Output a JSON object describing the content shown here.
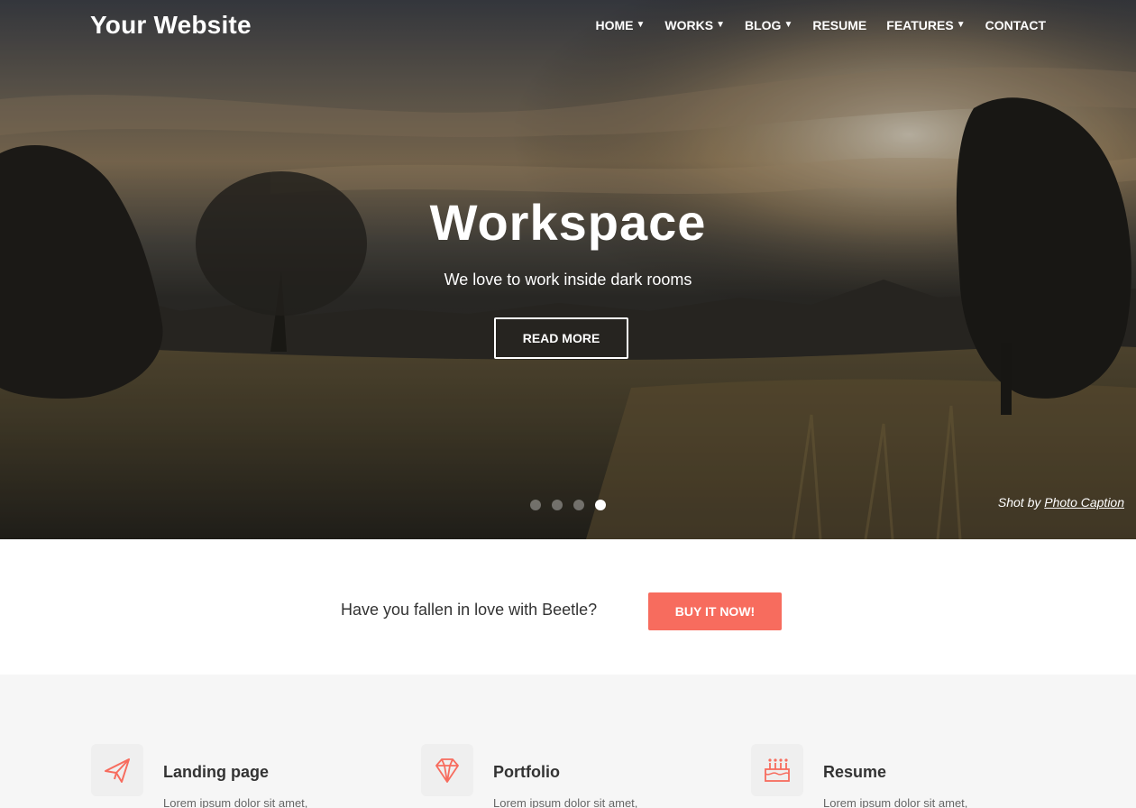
{
  "header": {
    "logo": "Your Website",
    "nav": [
      {
        "label": "HOME",
        "dropdown": true
      },
      {
        "label": "WORKS",
        "dropdown": true
      },
      {
        "label": "BLOG",
        "dropdown": true
      },
      {
        "label": "RESUME",
        "dropdown": false
      },
      {
        "label": "FEATURES",
        "dropdown": true
      },
      {
        "label": "CONTACT",
        "dropdown": false
      }
    ]
  },
  "hero": {
    "title": "Workspace",
    "subtitle": "We love to work inside dark rooms",
    "button_label": "READ MORE",
    "slides_total": 4,
    "active_slide": 4,
    "caption_prefix": "Shot by",
    "caption_link": "Photo Caption"
  },
  "cta": {
    "text": "Have you fallen in love with Beetle?",
    "button_label": "BUY IT NOW!"
  },
  "features": [
    {
      "title": "Landing page",
      "description": "Lorem ipsum dolor sit amet,",
      "icon": "paper-plane-icon"
    },
    {
      "title": "Portfolio",
      "description": "Lorem ipsum dolor sit amet,",
      "icon": "diamond-icon"
    },
    {
      "title": "Resume",
      "description": "Lorem ipsum dolor sit amet,",
      "icon": "cake-icon"
    }
  ],
  "colors": {
    "accent": "#f76c5e",
    "hero_text": "#ffffff",
    "section_bg": "#f6f6f6"
  }
}
